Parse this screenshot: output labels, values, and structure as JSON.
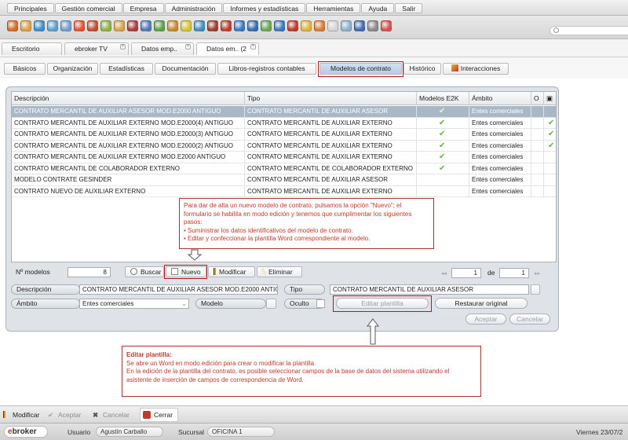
{
  "menu": [
    "Principales",
    "Gestión comercial",
    "Empresa",
    "Administración",
    "Informes y estadísticas",
    "Herramientas",
    "Ayuda",
    "Salir"
  ],
  "toolbar_icon_colors": [
    "#d96b1f",
    "#e3a13a",
    "#3b8fd1",
    "#5aa0d8",
    "#6f9fcf",
    "#e6532b",
    "#c84b2e",
    "#8fb43c",
    "#d9a441",
    "#b2393a",
    "#4f79b8",
    "#5aa347",
    "#c98b2c",
    "#d9c430",
    "#3f8fc7",
    "#9f3d2c",
    "#c23a2a",
    "#3a79c9",
    "#2f6eb5",
    "#6aa84f",
    "#3b78c4",
    "#c0392b",
    "#e0b634",
    "#e07b2e",
    "#d6d6d6",
    "#8fb0d0",
    "#3f6cb4",
    "#8a8a8a",
    "#d9504a"
  ],
  "doctabs": [
    "Escritorio",
    "ebroker TV",
    "Datos emp..",
    "Datos em.. (2"
  ],
  "subtabs": [
    "Básicos",
    "Organización",
    "Estadísticas",
    "Documentación",
    "Libros-registros contables",
    "Modelos de contrato",
    "Histórico",
    "Interacciones"
  ],
  "grid": {
    "headers": [
      "Descripción",
      "Tipo",
      "Modelos E2K",
      "Ámbito",
      "O"
    ],
    "rows": [
      {
        "desc": "CONTRATO MERCANTIL DE AUXILIAR ASESOR MOD.E2000 ANTIGUO",
        "tipo": "CONTRATO MERCANTIL DE AUXILIAR ASESOR",
        "e2k": true,
        "ambito": "Entes comerciales",
        "o": false,
        "selected": true
      },
      {
        "desc": "CONTRATO MERCANTIL DE AUXILIAR EXTERNO MOD.E2000(4) ANTIGUO",
        "tipo": "CONTRATO MERCANTIL DE AUXILIAR EXTERNO",
        "e2k": true,
        "ambito": "Entes comerciales",
        "o": true,
        "selected": false
      },
      {
        "desc": "CONTRATO MERCANTIL DE AUXILIAR EXTERNO MOD.E2000(3) ANTIGUO",
        "tipo": "CONTRATO MERCANTIL DE AUXILIAR EXTERNO",
        "e2k": true,
        "ambito": "Entes comerciales",
        "o": true,
        "selected": false
      },
      {
        "desc": "CONTRATO MERCANTIL DE AUXILIAR EXTERNO MOD.E2000(2) ANTIGUO",
        "tipo": "CONTRATO MERCANTIL DE AUXILIAR EXTERNO",
        "e2k": true,
        "ambito": "Entes comerciales",
        "o": true,
        "selected": false
      },
      {
        "desc": "CONTRATO MERCANTIL DE AUXILIAR EXTERNO MOD.E2000 ANTIGUO",
        "tipo": "CONTRATO MERCANTIL DE AUXILIAR EXTERNO",
        "e2k": true,
        "ambito": "Entes comerciales",
        "o": false,
        "selected": false
      },
      {
        "desc": "CONTRATO MERCANTIL DE COLABORADOR EXTERNO",
        "tipo": "CONTRATO MERCANTIL DE COLABORADOR EXTERNO",
        "e2k": true,
        "ambito": "Entes comerciales",
        "o": false,
        "selected": false
      },
      {
        "desc": "MODELO CONTRATE GESINDER",
        "tipo": "CONTRATO MERCANTIL DE AUXILIAR ASESOR",
        "e2k": false,
        "ambito": "Entes comerciales",
        "o": false,
        "selected": false
      },
      {
        "desc": "CONTRATO NUEVO DE AUXILIAR EXTERNO",
        "tipo": "CONTRATO MERCANTIL DE AUXILIAR EXTERNO",
        "e2k": false,
        "ambito": "Entes comerciales",
        "o": false,
        "selected": false
      }
    ]
  },
  "callout1": {
    "lines": [
      "Para dar de alta un nuevo modelo de contrato, pulsamos la opción \"Nuevo\"; el",
      "formulario se habilita en modo edición y tenemos que cumplimentar los siguientes",
      "pasos:",
      "• Suministrar los datos identificativos del modelo de contrato.",
      "• Editar y confeccionar la plantilla Word correspondiente al modelo."
    ]
  },
  "bottom": {
    "n_modelos_label": "Nº modelos",
    "n_modelos_value": "8",
    "buscar": "Buscar",
    "nuevo": "Nuevo",
    "modificar": "Modificar",
    "eliminar": "Eliminar",
    "page_current": "1",
    "page_de": "de",
    "page_total": "1",
    "descripcion_label": "Descripción",
    "descripcion_value": "CONTRATO MERCANTIL DE AUXILIAR ASESOR MOD.E2000 ANTIG",
    "tipo_label": "Tipo",
    "tipo_value": "CONTRATO MERCANTIL DE AUXILIAR ASESOR",
    "ambito_label": "Ámbito",
    "ambito_value": "Entes comerciales",
    "modelo_label": "Modelo",
    "oculto_label": "Oculto",
    "editar_plantilla": "Editar plantilla",
    "restaurar_original": "Restaurar original",
    "aceptar": "Aceptar",
    "cancelar": "Cancelar"
  },
  "callout2": {
    "title": "Editar plantilla:",
    "lines": [
      "Se abre un Word en modo edición para crear o modificar la plantilla.",
      "En la edición de la plantilla del contrato, es posible seleccionar campos de la base de datos del sistema utilizando el",
      "asistente de inserción de campos de correspondencia de Word."
    ]
  },
  "actionbar": {
    "modificar": "Modificar",
    "aceptar": "Aceptar",
    "cancelar": "Cancelar",
    "cerrar": "Cerrar"
  },
  "status": {
    "logo": "ebroker",
    "usuario_label": "Usuario",
    "usuario_value": "Agustín Carballo",
    "sucursal_label": "Sucursal",
    "sucursal_value": "OFICINA 1",
    "date": "Viernes 23/07/2"
  }
}
